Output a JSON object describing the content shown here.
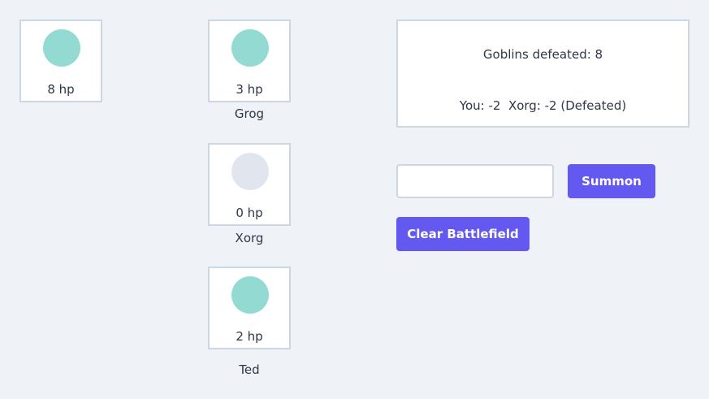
{
  "colors": {
    "background": "#eff3f7",
    "card_border": "#cdd7e1",
    "orb_alive": "#92dad2",
    "orb_defeated": "#e1e6ee",
    "button": "#6359f0"
  },
  "player": {
    "hp_label": "8 hp",
    "orb_state": "alive"
  },
  "enemies": [
    {
      "name": "Grog",
      "hp_label": "3 hp",
      "orb_state": "alive"
    },
    {
      "name": "Xorg",
      "hp_label": "0 hp",
      "orb_state": "defeated"
    },
    {
      "name": "Ted",
      "hp_label": "2 hp",
      "orb_state": "alive"
    }
  ],
  "status": {
    "goblins_defeated": "Goblins defeated: 8",
    "last_round": "You: -2  Xorg: -2 (Defeated)"
  },
  "summon": {
    "input_value": "",
    "input_placeholder": "",
    "button_label": "Summon"
  },
  "clear_button_label": "Clear Battlefield"
}
